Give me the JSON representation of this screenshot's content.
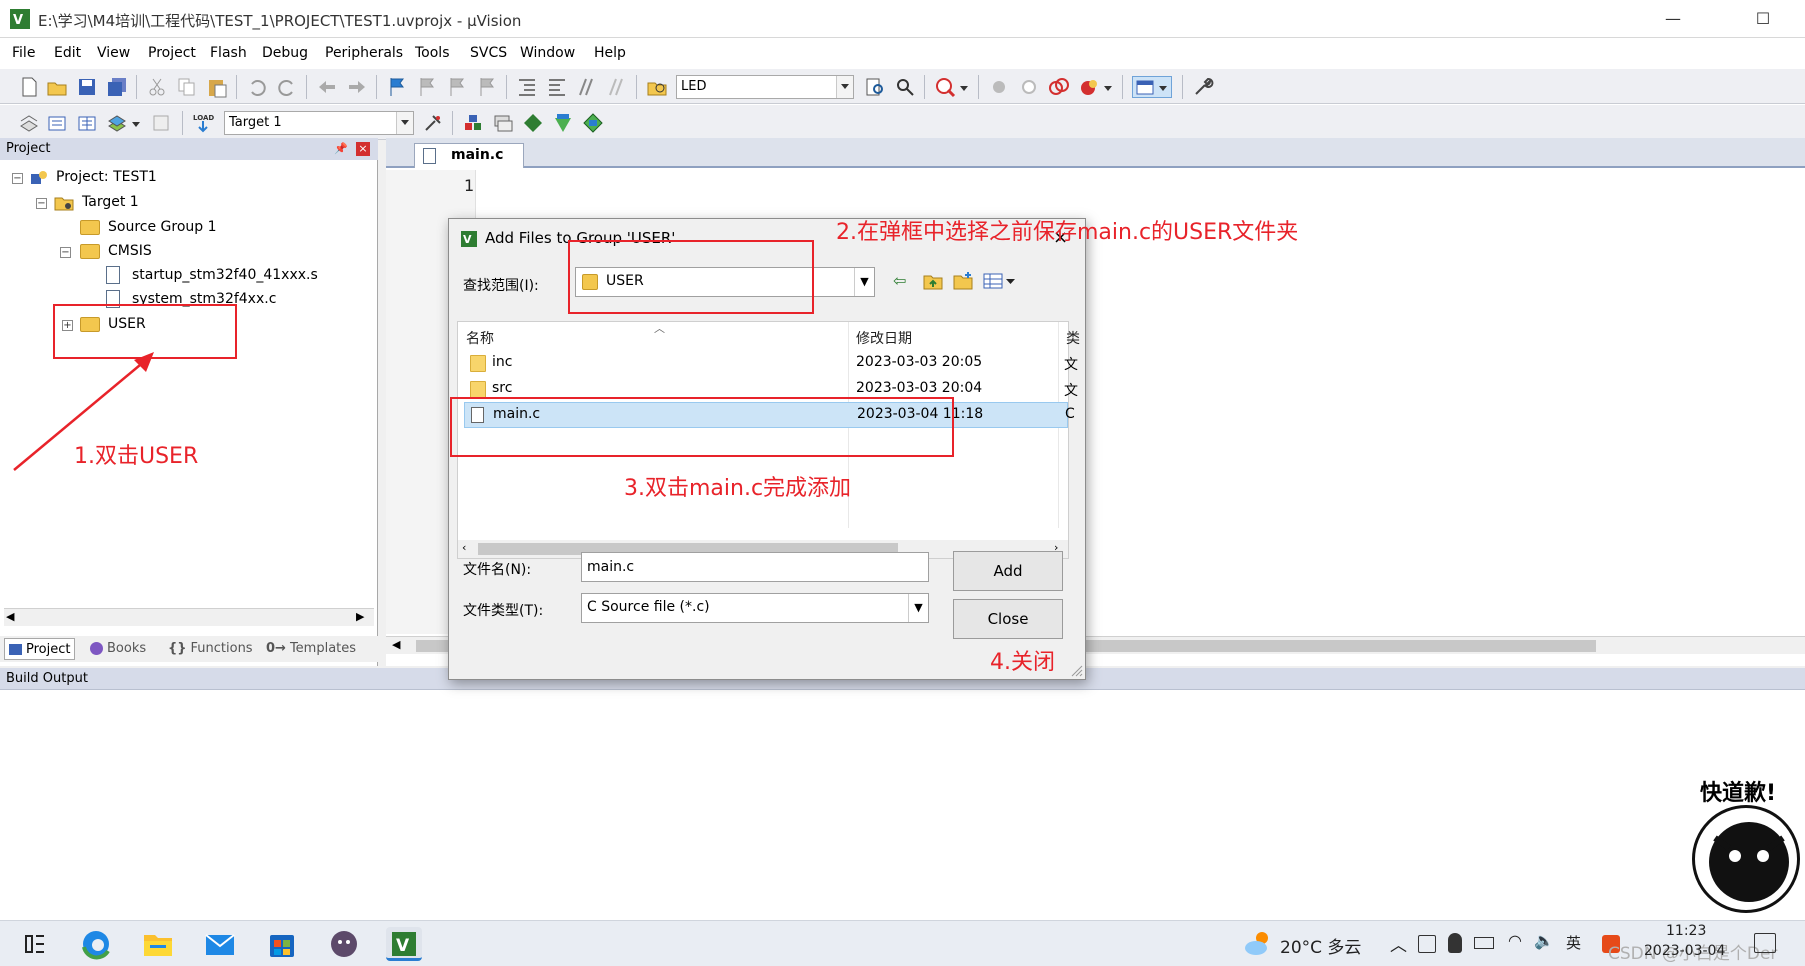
{
  "window": {
    "title": "E:\\学习\\M4培训\\工程代码\\TEST_1\\PROJECT\\TEST1.uvprojx - µVision"
  },
  "menu": [
    "File",
    "Edit",
    "View",
    "Project",
    "Flash",
    "Debug",
    "Peripherals",
    "Tools",
    "SVCS",
    "Window",
    "Help"
  ],
  "toolbar": {
    "find_value": "LED",
    "target_value": "Target 1"
  },
  "project_panel": {
    "title": "Project",
    "tree": {
      "project": "Project: TEST1",
      "target": "Target 1",
      "source_group": "Source Group 1",
      "cmsis": "CMSIS",
      "cmsis_files": [
        "startup_stm32f40_41xxx.s",
        "system_stm32f4xx.c"
      ],
      "user": "USER"
    },
    "tabs": [
      "Project",
      "Books",
      "Functions",
      "Templates"
    ]
  },
  "editor": {
    "tab": "main.c",
    "line_number": "1"
  },
  "build_output": {
    "title": "Build Output"
  },
  "dialog": {
    "title": "Add Files to Group 'USER'",
    "look_in_label": "查找范围(I):",
    "look_in_value": "USER",
    "columns": {
      "name": "名称",
      "date": "修改日期",
      "type": "类"
    },
    "files": [
      {
        "name": "inc",
        "date": "2023-03-03 20:05",
        "type": "文",
        "kind": "folder"
      },
      {
        "name": "src",
        "date": "2023-03-03 20:04",
        "type": "文",
        "kind": "folder"
      },
      {
        "name": "main.c",
        "date": "2023-03-04 11:18",
        "type": "C",
        "kind": "file"
      }
    ],
    "filename_label": "文件名(N):",
    "filename_value": "main.c",
    "filetype_label": "文件类型(T):",
    "filetype_value": "C Source file (*.c)",
    "add_button": "Add",
    "close_button": "Close"
  },
  "annotations": {
    "step1": "1.双击USER",
    "step2": "2.在弹框中选择之前保存main.c的USER文件夹",
    "step3": "3.双击main.c完成添加",
    "step4": "4.关闭",
    "sticker": "快道歉!"
  },
  "taskbar": {
    "weather": "20°C 多云",
    "time": "11:23",
    "date": "2023-03-04",
    "watermark": "CSDN @小白是个Der"
  },
  "colors": {
    "annotation_red": "#e8232a",
    "selection_blue": "#cce4f7",
    "panel_header": "#d6dbe9"
  }
}
